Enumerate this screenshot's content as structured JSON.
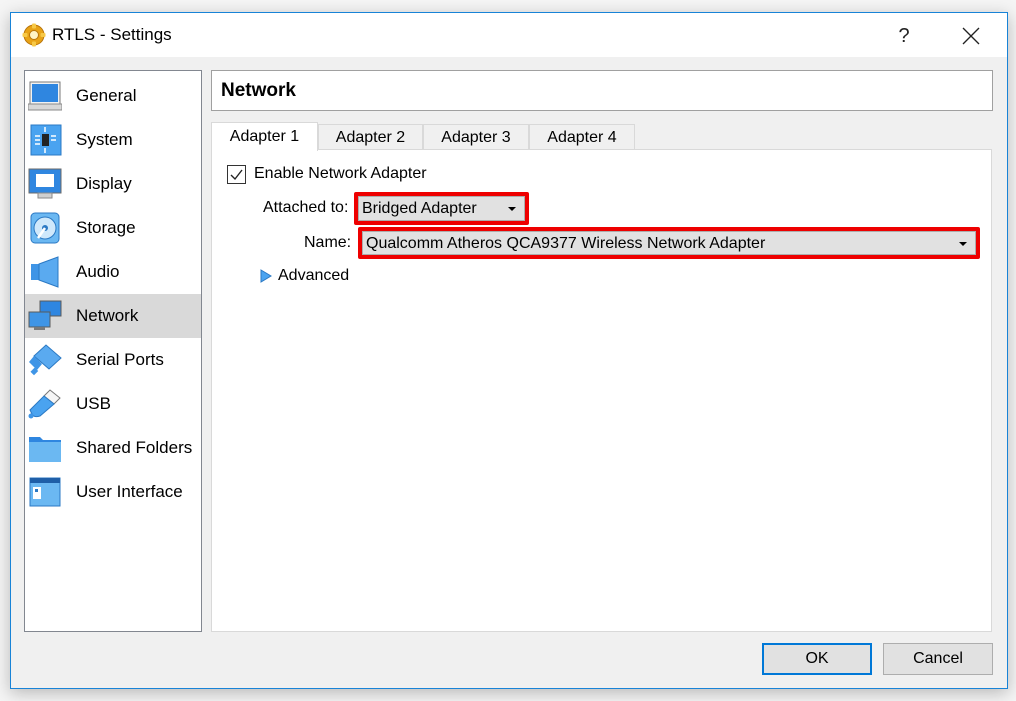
{
  "window": {
    "title": "RTLS - Settings",
    "help_label": "?",
    "icons": {
      "app": "gear-icon",
      "close": "close-icon"
    }
  },
  "sidebar": {
    "selected": "Network",
    "items": [
      {
        "label": "General",
        "icon": "monitor-icon"
      },
      {
        "label": "System",
        "icon": "chip-icon"
      },
      {
        "label": "Display",
        "icon": "display-icon"
      },
      {
        "label": "Storage",
        "icon": "disk-icon"
      },
      {
        "label": "Audio",
        "icon": "speaker-icon"
      },
      {
        "label": "Network",
        "icon": "network-icon"
      },
      {
        "label": "Serial Ports",
        "icon": "serial-port-icon"
      },
      {
        "label": "USB",
        "icon": "usb-icon"
      },
      {
        "label": "Shared Folders",
        "icon": "folder-icon"
      },
      {
        "label": "User Interface",
        "icon": "window-icon"
      }
    ]
  },
  "header": {
    "title": "Network"
  },
  "tabs": [
    {
      "label": "Adapter 1",
      "active": true
    },
    {
      "label": "Adapter 2",
      "active": false
    },
    {
      "label": "Adapter 3",
      "active": false
    },
    {
      "label": "Adapter 4",
      "active": false
    }
  ],
  "adapter": {
    "enable_label": "Enable Network Adapter",
    "enabled": true,
    "attached_label": "Attached to:",
    "attached_value": "Bridged Adapter",
    "name_label": "Name:",
    "name_value": "Qualcomm Atheros QCA9377 Wireless Network Adapter",
    "advanced_label": "Advanced",
    "highlight_color": "#ee0000"
  },
  "buttons": {
    "ok": "OK",
    "cancel": "Cancel"
  },
  "colors": {
    "accent": "#0078d7",
    "window_border": "#1883d7",
    "selection": "#d9d9d9"
  }
}
